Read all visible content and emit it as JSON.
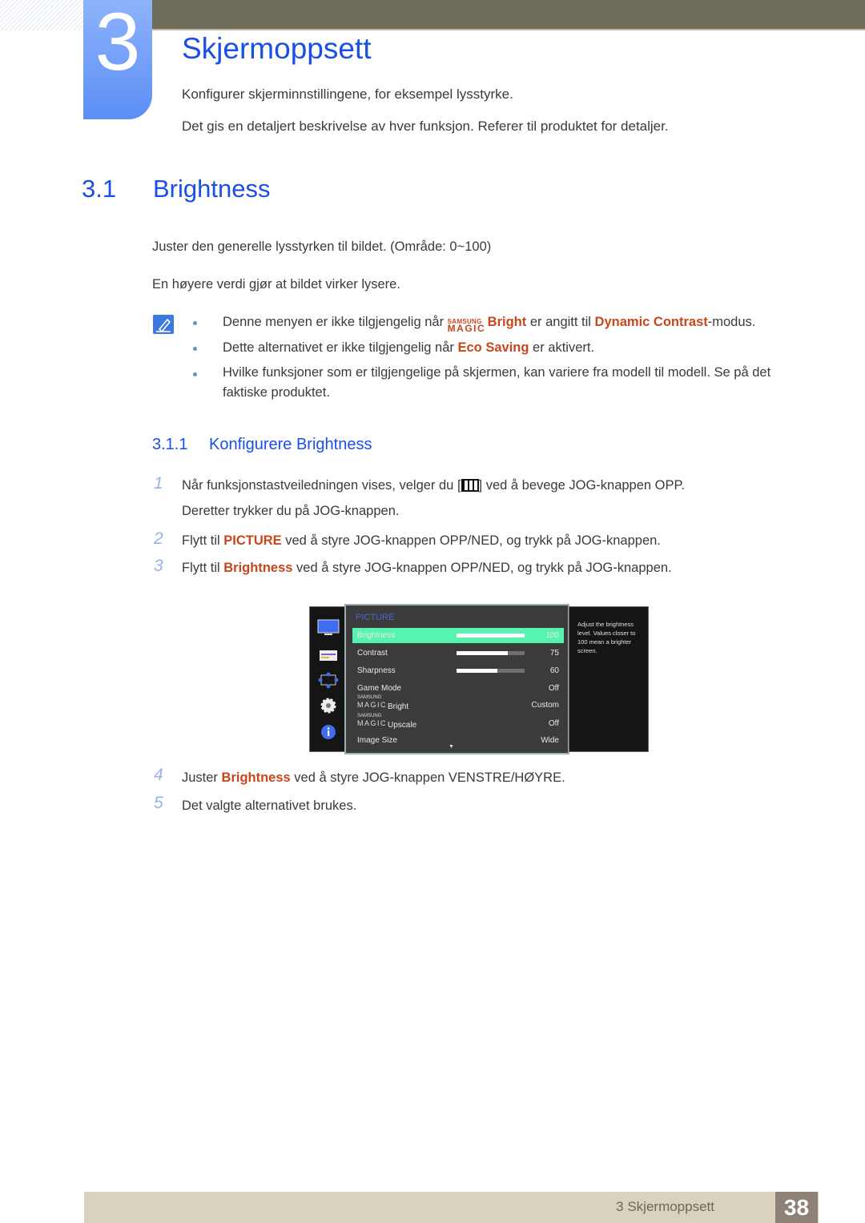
{
  "chapter": {
    "number": "3",
    "title": "Skjermoppsett",
    "intro": [
      "Konfigurer skjerminnstillingene, for eksempel lysstyrke.",
      "Det gis en detaljert beskrivelse av hver funksjon. Referer til produktet for detaljer."
    ]
  },
  "section": {
    "number": "3.1",
    "title": "Brightness",
    "paragraphs": [
      "Juster den generelle lysstyrken til bildet. (Område: 0~100)",
      "En høyere verdi gjør at bildet virker lysere."
    ]
  },
  "notes": {
    "icon": "note-pencil-icon",
    "items": [
      {
        "pre": "Denne menyen er ikke tilgjengelig når ",
        "magic_top": "SAMSUNG",
        "magic_bottom": "MAGIC",
        "hl1": "Bright",
        "mid": " er angitt til ",
        "hl2": "Dynamic Contrast",
        "post": "-modus."
      },
      {
        "pre": "Dette alternativet er ikke tilgjengelig når ",
        "hl1": "Eco Saving",
        "post": " er aktivert."
      },
      {
        "line1": "Hvilke funksjoner som er tilgjengelige på skjermen, kan variere fra modell til modell. Se på det",
        "line2": "faktiske produktet."
      }
    ]
  },
  "subsection": {
    "number": "3.1.1",
    "title": "Konfigurere Brightness",
    "steps": [
      {
        "num": "1",
        "pre": "Når funksjonstastveiledningen vises, velger du [",
        "icon": "menu-icon",
        "post": "] ved å bevege JOG-knappen OPP.",
        "line2": "Deretter trykker du på JOG-knappen."
      },
      {
        "num": "2",
        "pre": "Flytt til ",
        "hl": "PICTURE",
        "post": " ved å styre JOG-knappen OPP/NED, og trykk på JOG-knappen."
      },
      {
        "num": "3",
        "pre": "Flytt til ",
        "hl": "Brightness",
        "post": " ved å styre JOG-knappen OPP/NED, og trykk på JOG-knappen."
      },
      {
        "num": "4",
        "pre": "Juster ",
        "hl": "Brightness",
        "post": " ved å styre JOG-knappen VENSTRE/HØYRE."
      },
      {
        "num": "5",
        "pre": "Det valgte alternativet brukes."
      }
    ]
  },
  "osd": {
    "title": "PICTURE",
    "side_icons": [
      "monitor-icon",
      "picture-settings-icon",
      "size-position-icon",
      "gear-icon",
      "info-icon"
    ],
    "rows": [
      {
        "label": "Brightness",
        "value": "100",
        "level": 100,
        "selected": true
      },
      {
        "label": "Contrast",
        "value": "75",
        "level": 75
      },
      {
        "label": "Sharpness",
        "value": "60",
        "level": 60
      },
      {
        "label": "Game Mode",
        "value": "Off"
      },
      {
        "magic_top": "SAMSUNG",
        "magic_bottom": "MAGIC",
        "label": "Bright",
        "value": "Custom"
      },
      {
        "magic_top": "SAMSUNG",
        "magic_bottom": "MAGIC",
        "label": "Upscale",
        "value": "Off"
      },
      {
        "label": "Image Size",
        "value": "Wide"
      }
    ],
    "help": "Adjust the brightness level. Values closer to 100 mean a brighter screen.",
    "accent": "#56f4b0"
  },
  "footer": {
    "chapter_label": "3 Skjermoppsett",
    "page": "38"
  },
  "colors": {
    "heading": "#1a4fe6",
    "highlight": "#c8461b",
    "topbar": "#6e6b58",
    "footer": "#d8d2bf"
  }
}
